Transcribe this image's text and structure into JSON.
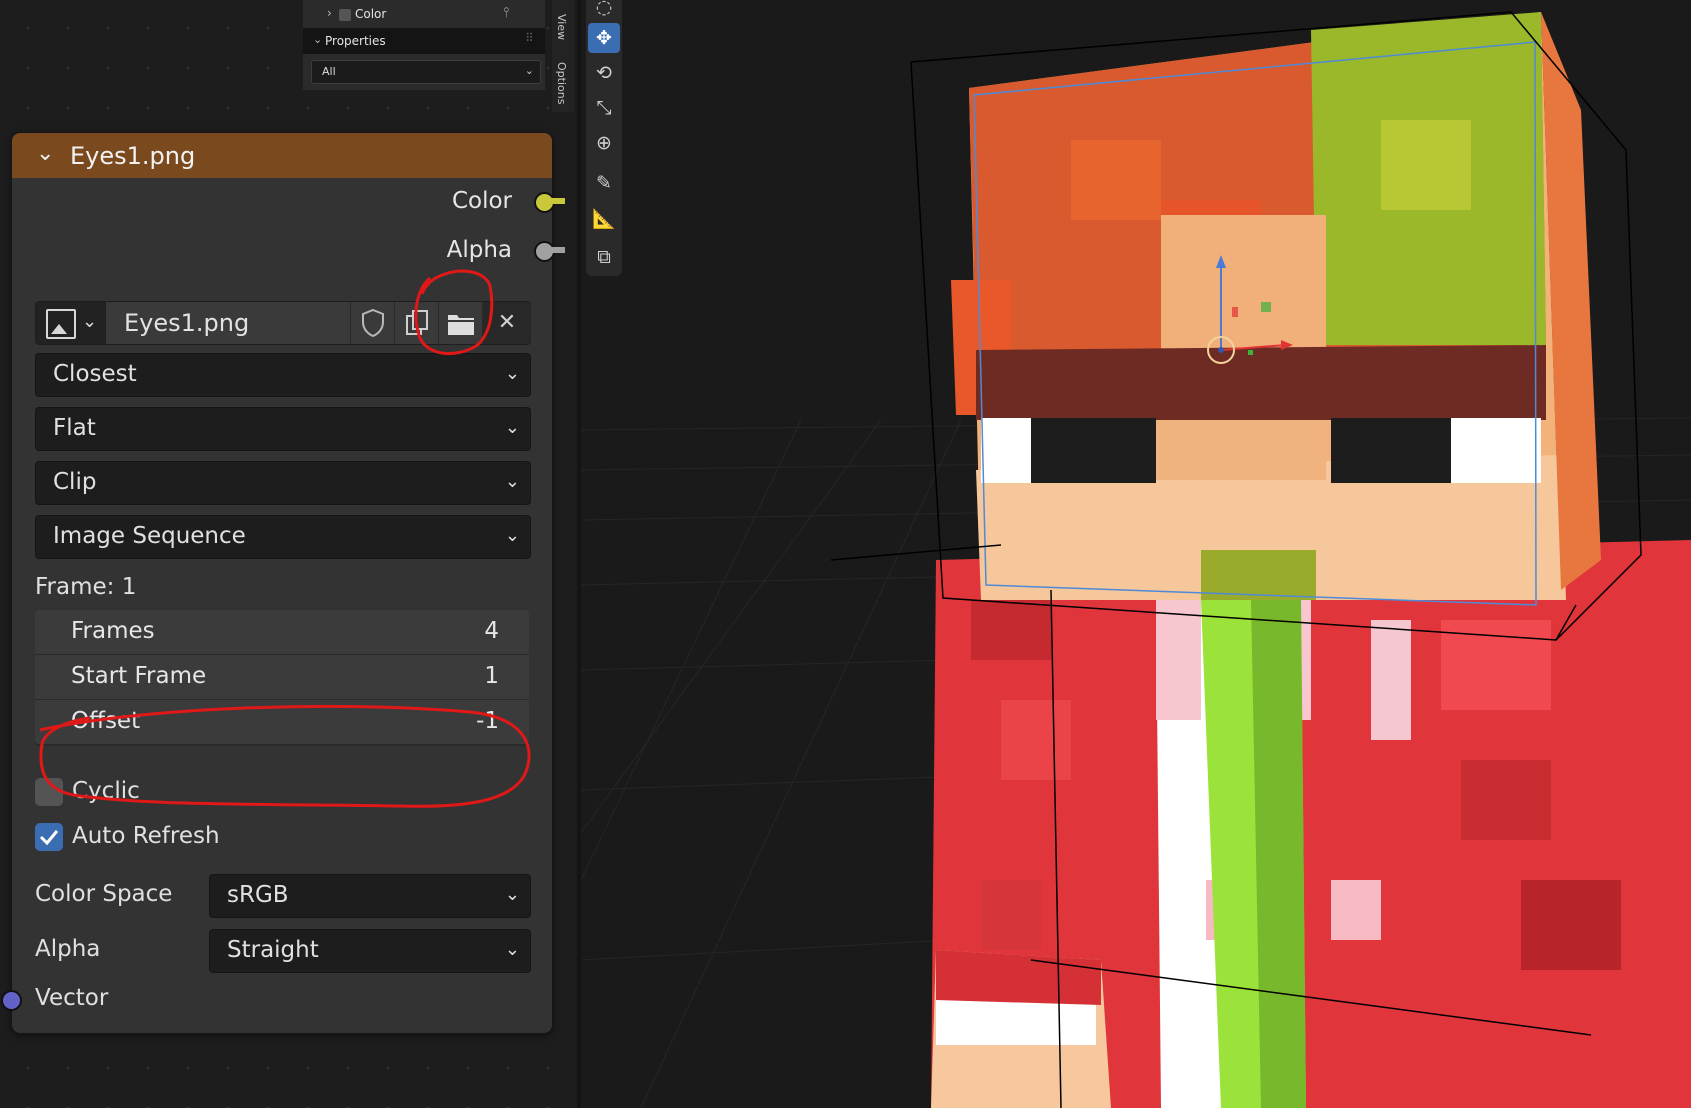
{
  "side_panel": {
    "color_label": "Color",
    "properties_label": "Properties",
    "filter_value": "All",
    "tabs": [
      "View",
      "Options"
    ]
  },
  "node": {
    "title": "Eyes1.png",
    "header_color": "#7a4a1e",
    "outputs": [
      {
        "label": "Color",
        "socket_color": "#c8c83a"
      },
      {
        "label": "Alpha",
        "socket_color": "#a0a0a0"
      }
    ],
    "image_name": "Eyes1.png",
    "interpolation": "Closest",
    "projection": "Flat",
    "extension": "Clip",
    "source": "Image Sequence",
    "frame_label": "Frame: 1",
    "frames": {
      "label": "Frames",
      "value": "4"
    },
    "start_frame": {
      "label": "Start Frame",
      "value": "1"
    },
    "offset": {
      "label": "Offset",
      "value": "-1"
    },
    "cyclic": {
      "label": "Cyclic",
      "checked": false
    },
    "auto_refresh": {
      "label": "Auto Refresh",
      "checked": true
    },
    "color_space": {
      "label": "Color Space",
      "value": "sRGB"
    },
    "alpha": {
      "label": "Alpha",
      "value": "Straight"
    },
    "input": {
      "label": "Vector",
      "socket_color": "#6363c7"
    }
  },
  "annotation_color": "#e01818",
  "accent_color": "#3b6db3",
  "viewport": {
    "tools": [
      "cursor-icon",
      "move-icon",
      "rotate-icon",
      "scale-icon",
      "transform-icon",
      "annotate-icon",
      "measure-icon",
      "add-cube-icon"
    ]
  }
}
